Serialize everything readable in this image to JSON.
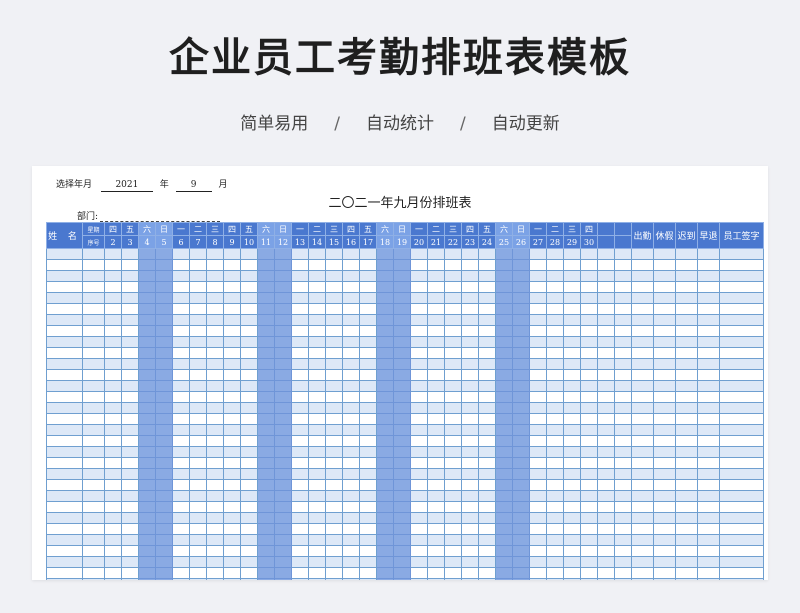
{
  "page": {
    "title": "企业员工考勤排班表模板",
    "features": [
      "简单易用",
      "自动统计",
      "自动更新"
    ],
    "separator": "/"
  },
  "sheet": {
    "select_label": "选择年月",
    "year": "2021",
    "year_unit": "年",
    "month": "9",
    "month_unit": "月",
    "dept_label": "部门:",
    "title": "二〇二一年九月份排班表"
  },
  "table": {
    "name_header": "姓 名",
    "weekday_label": "星期",
    "number_label": "序号",
    "weekdays": [
      "四",
      "五",
      "六",
      "日",
      "一",
      "二",
      "三",
      "四",
      "五",
      "六",
      "日",
      "一",
      "二",
      "三",
      "四",
      "五",
      "六",
      "日",
      "一",
      "二",
      "三",
      "四",
      "五",
      "六",
      "日",
      "一",
      "二",
      "三",
      "四",
      "",
      ""
    ],
    "dates": [
      "2",
      "3",
      "4",
      "5",
      "6",
      "7",
      "8",
      "9",
      "10",
      "11",
      "12",
      "13",
      "14",
      "15",
      "16",
      "17",
      "18",
      "19",
      "20",
      "21",
      "22",
      "23",
      "24",
      "25",
      "26",
      "27",
      "28",
      "29",
      "30",
      "",
      ""
    ],
    "stat_headers": [
      "出勤",
      "休假",
      "迟到",
      "早退",
      "员工签字"
    ],
    "row_count": 31
  },
  "colors": {
    "header_blue": "#4a78cf",
    "weekend_blue": "#8aaae3",
    "stripe_light": "#dde8f7",
    "border": "#6f9fd0"
  }
}
